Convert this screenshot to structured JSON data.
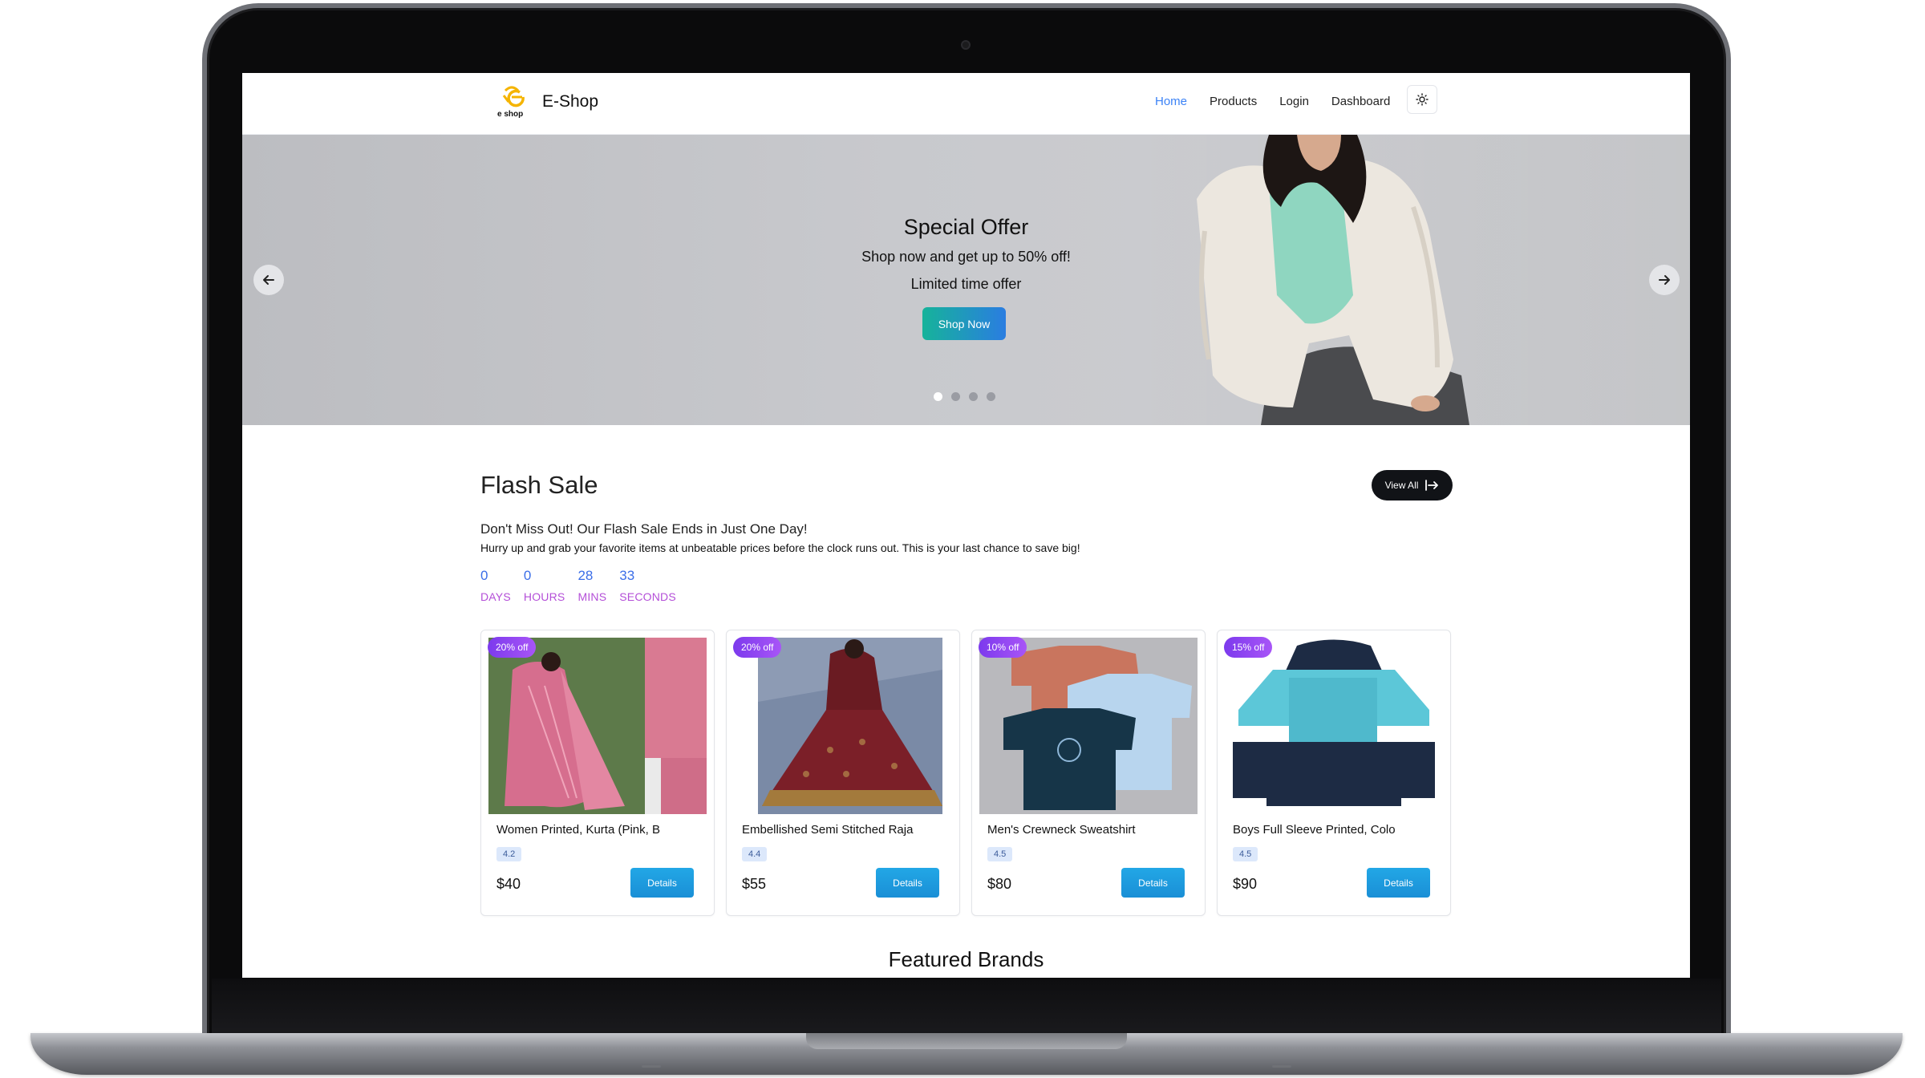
{
  "navbar": {
    "logo_text": "e shop",
    "brand": "E-Shop",
    "links": [
      {
        "label": "Home",
        "active": true
      },
      {
        "label": "Products",
        "active": false
      },
      {
        "label": "Login",
        "active": false
      },
      {
        "label": "Dashboard",
        "active": false
      }
    ],
    "theme_toggle_icon": "sun-icon"
  },
  "hero": {
    "title": "Special Offer",
    "subtitle": "Shop now and get up to 50% off!",
    "note": "Limited time offer",
    "button": "Shop Now",
    "prev_icon": "arrow-left-icon",
    "next_icon": "arrow-right-icon",
    "slides": 4,
    "active_slide": 1
  },
  "flash_sale": {
    "title": "Flash Sale",
    "view_all": "View All",
    "headline": "Don't Miss Out! Our Flash Sale Ends in Just One Day!",
    "description": "Hurry up and grab your favorite items at unbeatable prices before the clock runs out. This is your last chance to save big!",
    "countdown": [
      {
        "value": "0",
        "label": "DAYS"
      },
      {
        "value": "0",
        "label": "HOURS"
      },
      {
        "value": "28",
        "label": "MINS"
      },
      {
        "value": "33",
        "label": "SECONDS"
      }
    ],
    "products": [
      {
        "discount": "20% off",
        "name": "Women Printed, Kurta (Pink, B",
        "rating": "4.2",
        "price": "$40",
        "button": "Details"
      },
      {
        "discount": "20% off",
        "name": "Embellished Semi Stitched Raja",
        "rating": "4.4",
        "price": "$55",
        "button": "Details"
      },
      {
        "discount": "10% off",
        "name": "Men's Crewneck Sweatshirt",
        "rating": "4.5",
        "price": "$80",
        "button": "Details"
      },
      {
        "discount": "15% off",
        "name": "Boys Full Sleeve Printed, Colo",
        "rating": "4.5",
        "price": "$90",
        "button": "Details"
      }
    ]
  },
  "featured_brands": {
    "title": "Featured Brands"
  },
  "colors": {
    "accent_blue": "#3b82f6",
    "countdown_number": "#3b6ee8",
    "countdown_label": "#b44fd8",
    "badge_purple": "#8b3ff0",
    "details_button": "#1fa0e2"
  }
}
